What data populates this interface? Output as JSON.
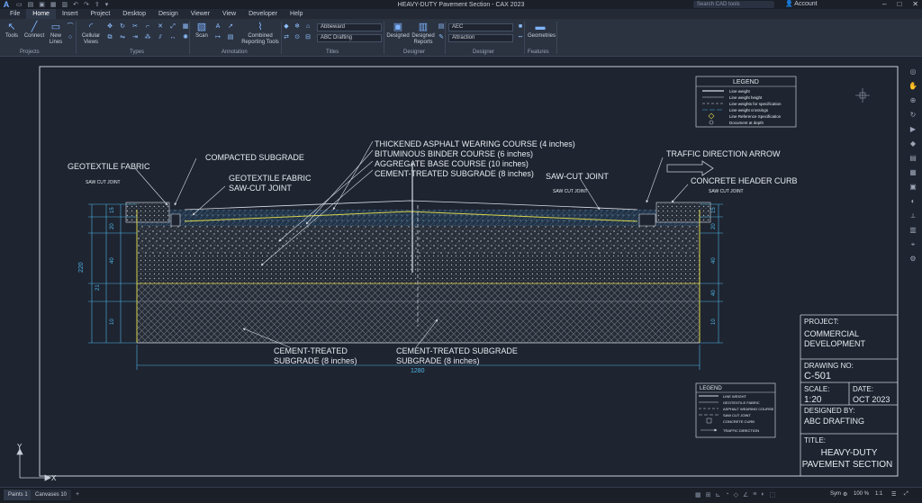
{
  "titlebar": {
    "title": "HEAVY-DUTY Pavement Section - CAX 2023",
    "search_placeholder": "Search CAD tools",
    "user": "Account",
    "logo": "A"
  },
  "menu": {
    "tabs": [
      "File",
      "Home",
      "Insert",
      "Project",
      "Desktop",
      "Design",
      "Viewer",
      "View",
      "Developer",
      "Help"
    ],
    "active_index": 1
  },
  "ribbon": {
    "tools": {
      "tool_1": "Tools",
      "tool_2": "Connect",
      "tool_3": "New Lines",
      "tool_4": "Cellular Views",
      "tool_5": "Scan",
      "tool_6": "Combined Reporting Tools",
      "tool_7": "Designed",
      "tool_8": "Designed Reports",
      "tool_9": "Geometries"
    },
    "dropdowns": {
      "style": "Abbeward",
      "font": "ABC Drafting",
      "layer": "AEC",
      "annotation": "Attraction"
    },
    "groups": [
      "Projects",
      "Types",
      "Annotation",
      "Titles",
      "Designer",
      "Designer",
      "Features"
    ]
  },
  "drawing": {
    "legend_top": {
      "title": "LEGEND",
      "items": [
        "Line weight",
        "Line weight height",
        "Line weights for specification",
        "Line weight crossings",
        "Line Reference Specification",
        "Document at depth"
      ]
    },
    "callouts": {
      "geotextile_left": "GEOTEXTILE FABRIC",
      "compacted": "COMPACTED SUBGRADE",
      "geotextile_mid": "GEOTEXTILE FABRIC",
      "sawcut_mid": "SAW-CUT JOINT",
      "thickened": "THICKENED ASPHALT WEARING COURSE (4 inches)",
      "binder": "BITUMINOUS BINDER COURSE (6 inches)",
      "aggregate": "AGGREGATE BASE COURSE (10 inches)",
      "cement_top": "CEMENT-TREATED SUBGRADE (8 inches)",
      "sawcut_right": "SAW-CUT JOINT",
      "traffic": "TRAFFIC DIRECTION ARROW",
      "curb": "CONCRETE HEADER CURB",
      "cement_left_1": "CEMENT-TREATED",
      "cement_left_2": "SUBGRADE (8 inches)",
      "cement_bot_1": "CEMENT-TREATED SUBGRADE",
      "cement_bot_2": "SUBGRADE (8 inches)",
      "small_sawcut_left": "SAW CUT JOINT",
      "small_sawcut_mid": "SAW CUT JOINT",
      "small_sawcut_right": "SAW CUT JOINT"
    },
    "dims": {
      "left_total": "220",
      "left_1": "15",
      "left_2": "20",
      "left_3": "40",
      "left_4": "21",
      "left_5": "10",
      "right_1": "15",
      "right_2": "20",
      "right_3": "40",
      "right_4": "40",
      "right_5": "10",
      "bottom": "1280"
    },
    "legend_bottom": {
      "title": "LEGEND",
      "items": [
        "LINE WEIGHT",
        "GEOTEXTILE FABRIC",
        "ASPHALT WEARING COURSE",
        "SAW CUT JOINT",
        "CONCRETE CURB",
        "TRAFFIC DIRECTION"
      ]
    },
    "ucs": {
      "x": "X",
      "y": "Y"
    }
  },
  "title_block": {
    "project_label": "PROJECT:",
    "project_value_1": "COMMERCIAL",
    "project_value_2": "DEVELOPMENT",
    "drawing_no_label": "DRAWING NO:",
    "drawing_no_value": "C-501",
    "scale_label": "SCALE:",
    "scale_value": "1:20",
    "date_label": "DATE:",
    "date_value": "OCT 2023",
    "designed_label": "DESIGNED BY:",
    "designed_value": "ABC DRAFTING",
    "title_label": "TITLE:",
    "title_value_1": "HEAVY-DUTY",
    "title_value_2": "PAVEMENT SECTION"
  },
  "status": {
    "tab_1": "Paints 1",
    "tab_2": "Canvases 10",
    "coord": "Sym",
    "zoom": "100 %",
    "scale": "1:1"
  },
  "colors": {
    "accent": "#4fb6e8",
    "sheet_border": "#c9ced8",
    "yellow_line": "#d6d24a",
    "background": "#1e2430"
  }
}
